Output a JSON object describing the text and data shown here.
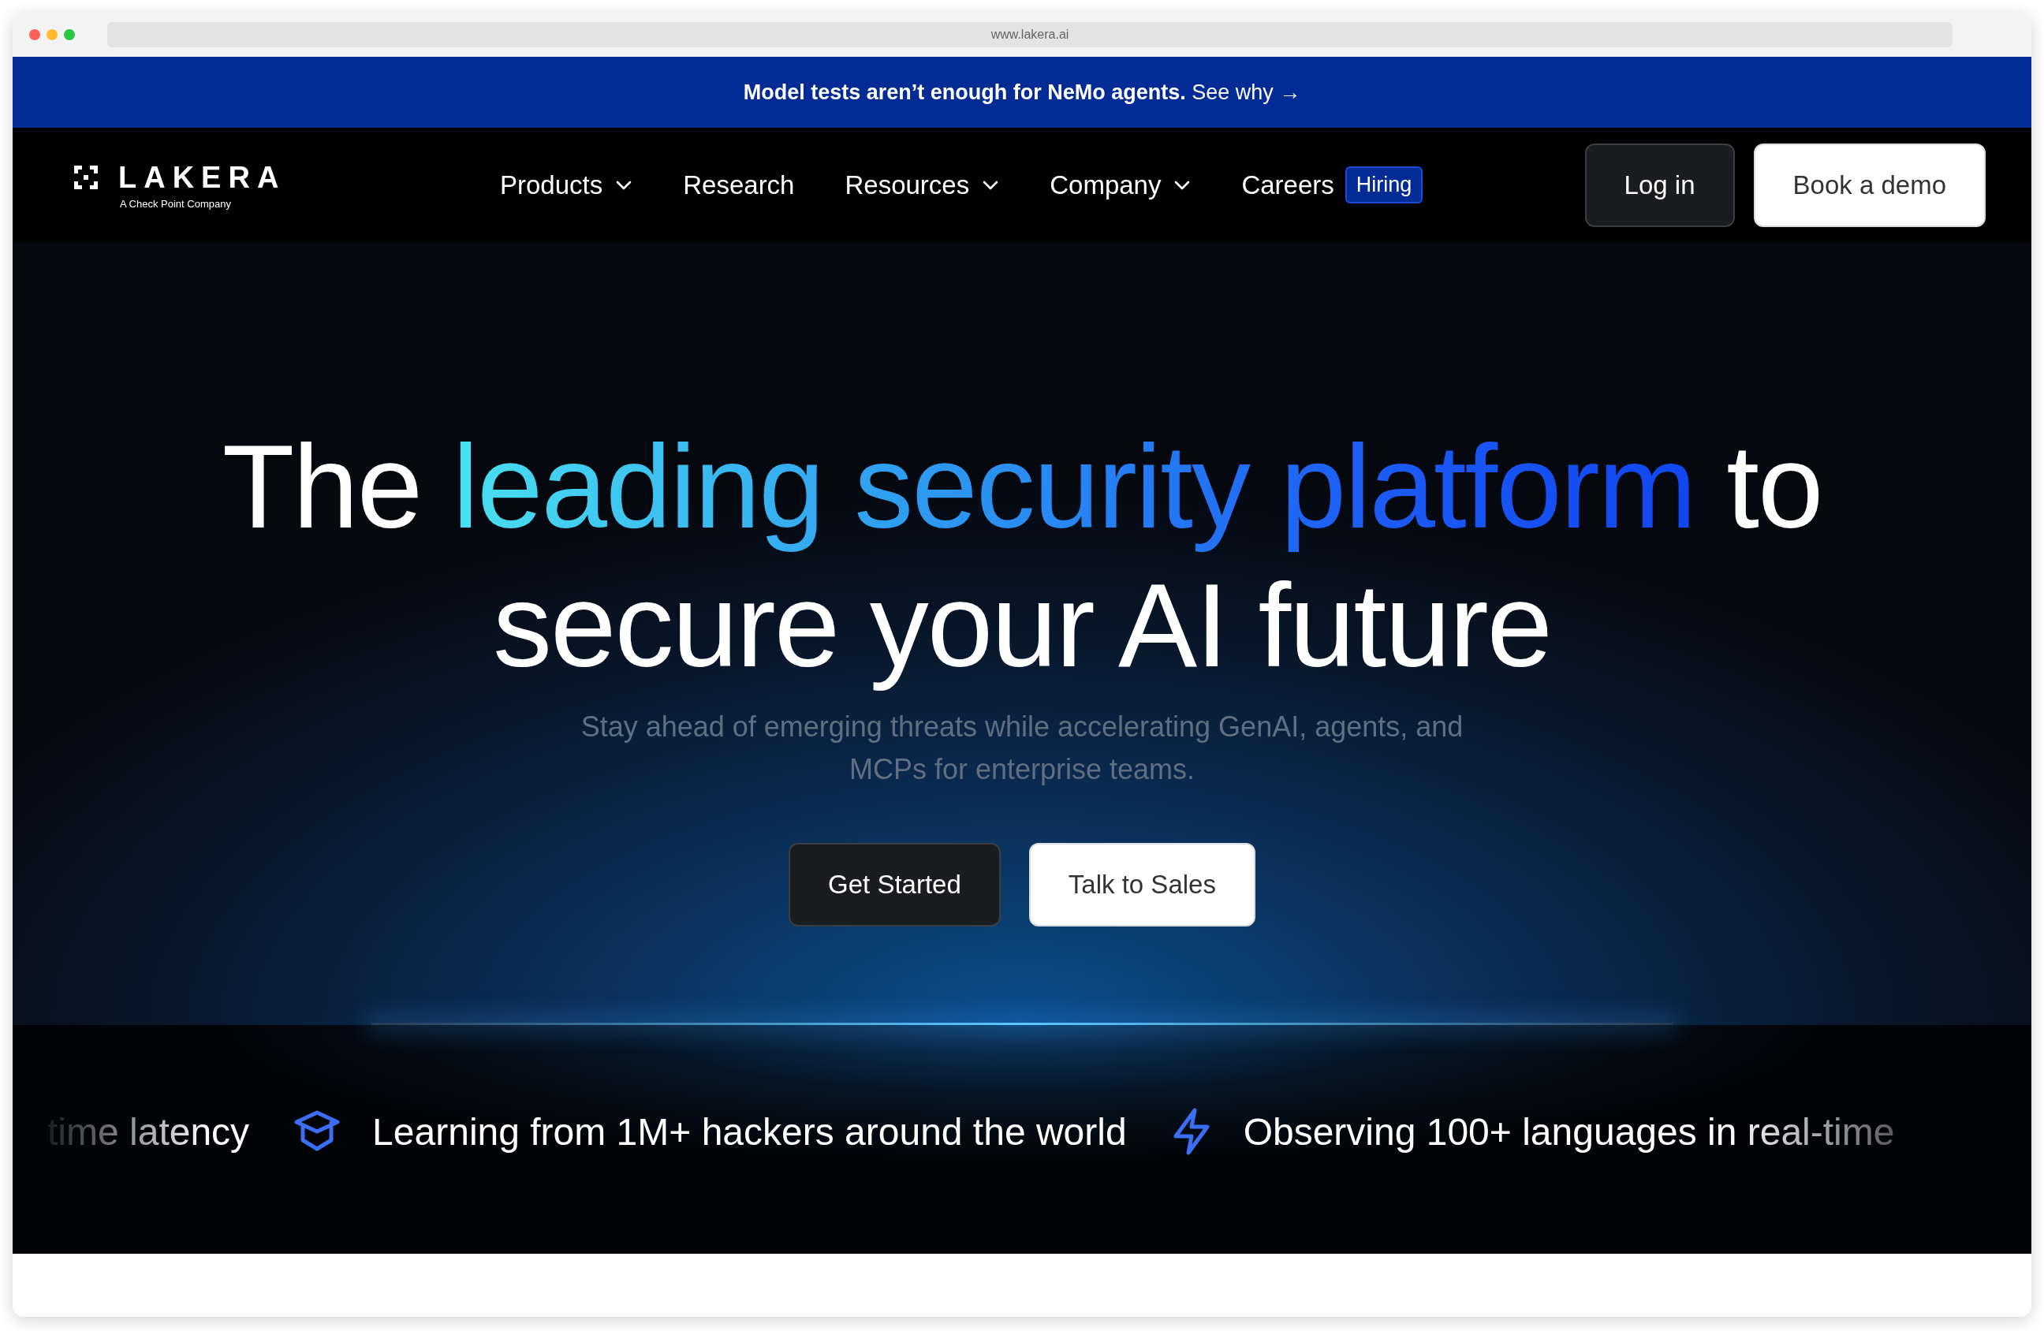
{
  "browser": {
    "url": "www.lakera.ai"
  },
  "banner": {
    "text": "**Model tests aren’t enough for NeMo agents.** See why →"
  },
  "nav": {
    "logo": "LAKERA",
    "logo_tagline": "A Check Point Company",
    "items": [
      {
        "label": "Products",
        "has_dropdown": true
      },
      {
        "label": "Research",
        "has_dropdown": false
      },
      {
        "label": "Resources",
        "has_dropdown": true
      },
      {
        "label": "Company",
        "has_dropdown": true
      },
      {
        "label": "Careers",
        "has_dropdown": false,
        "badge": "Hiring"
      }
    ],
    "buttons": [
      {
        "label": "Log in",
        "kind": "dark"
      },
      {
        "label": "Book a demo",
        "kind": "light"
      }
    ]
  },
  "hero": {
    "headline": [
      [
        {
          "text": "The ",
          "accent": false
        },
        {
          "text": "leading security platform",
          "accent": true
        },
        {
          "text": " to",
          "accent": false
        }
      ],
      [
        {
          "text": "secure your AI future",
          "accent": false
        }
      ]
    ],
    "subtitle": "Stay ahead of emerging threats while accelerating GenAI, agents, and MCPs for enterprise teams.",
    "buttons": [
      {
        "label": "Get Started",
        "kind": "dark"
      },
      {
        "label": "Talk to Sales",
        "kind": "light"
      }
    ]
  },
  "marquee": [
    {
      "text": "time latency",
      "kind": "plain"
    },
    {
      "text": "Learning from 1M+ hackers around the world",
      "kind": "learning"
    },
    {
      "text": "Observing 100+ languages in real-time",
      "kind": "languages"
    }
  ]
}
